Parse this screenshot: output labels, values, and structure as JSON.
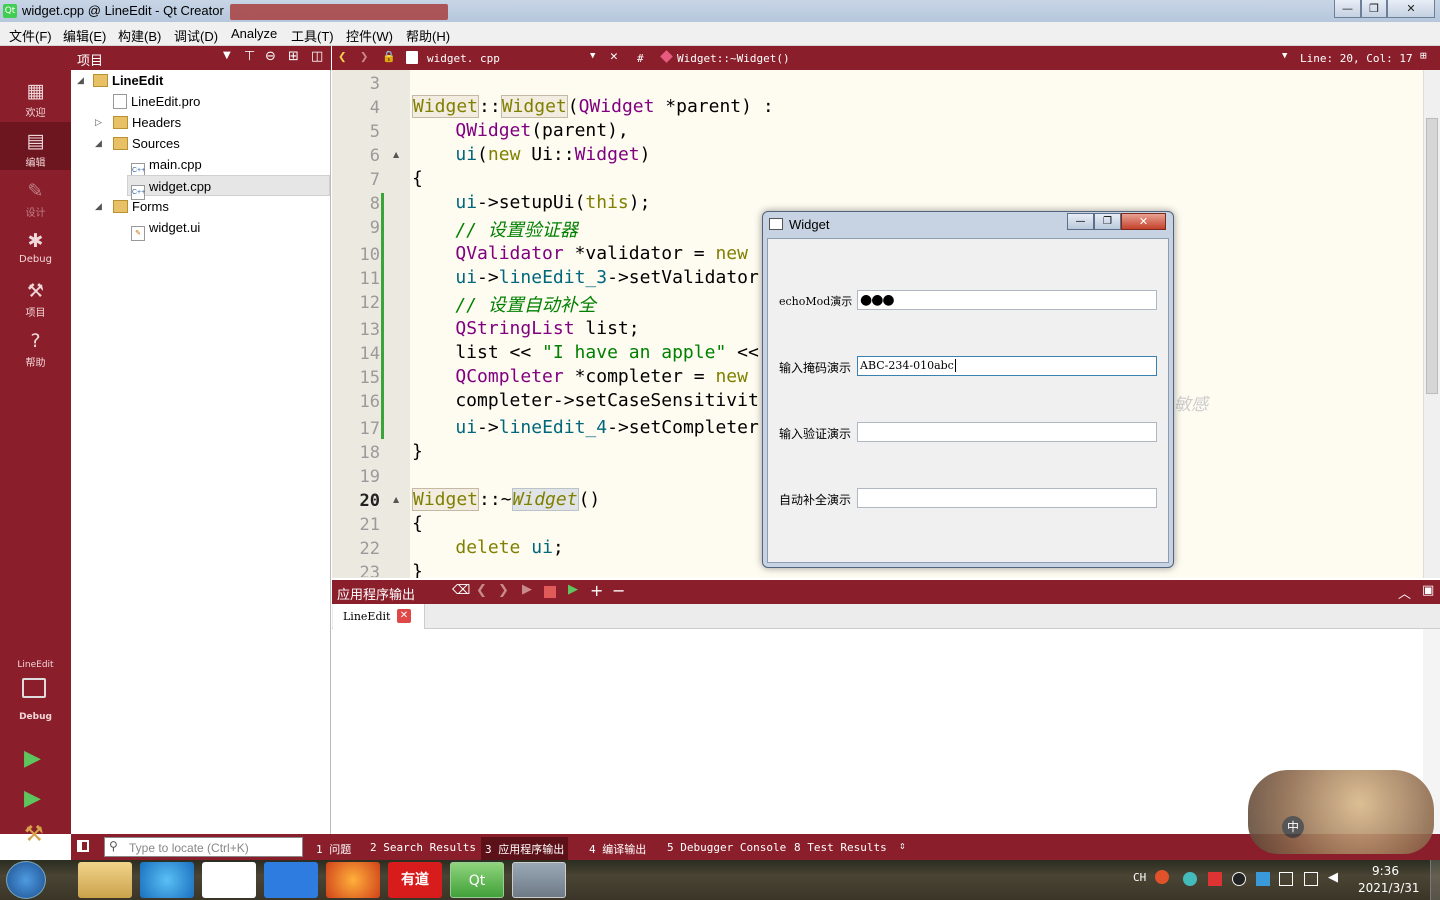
{
  "window": {
    "title": "widget.cpp @ LineEdit - Qt Creator",
    "min": "—",
    "max": "❐",
    "close": "✕"
  },
  "menu": [
    "文件(F)",
    "编辑(E)",
    "构建(B)",
    "调试(D)",
    "Analyze",
    "工具(T)",
    "控件(W)",
    "帮助(H)"
  ],
  "modes": [
    {
      "label": "欢迎",
      "icon": "grid-icon"
    },
    {
      "label": "编辑",
      "icon": "edit-icon"
    },
    {
      "label": "设计",
      "icon": "pencil-icon"
    },
    {
      "label": "Debug",
      "icon": "bug-icon"
    },
    {
      "label": "项目",
      "icon": "wrench-icon"
    },
    {
      "label": "帮助",
      "icon": "help-icon"
    }
  ],
  "kit": {
    "project": "LineEdit",
    "mode": "Debug"
  },
  "project_panel": {
    "title": "项目"
  },
  "tree": [
    {
      "label": "LineEdit"
    },
    {
      "label": "LineEdit.pro"
    },
    {
      "label": "Headers"
    },
    {
      "label": "Sources"
    },
    {
      "label": "main.cpp"
    },
    {
      "label": "widget.cpp"
    },
    {
      "label": "Forms"
    },
    {
      "label": "widget.ui"
    }
  ],
  "editor": {
    "file": "widget. cpp",
    "hash": "#",
    "symbol": "Widget::~Widget()",
    "position": "Line: 20, Col: 17"
  },
  "line_numbers": [
    "3",
    "4",
    "5",
    "6",
    "7",
    "8",
    "9",
    "10",
    "11",
    "12",
    "13",
    "14",
    "15",
    "16",
    "17",
    "18",
    "19",
    "20",
    "21",
    "22",
    "23"
  ],
  "code": {
    "l4_a": "Widget",
    "l4_b": "::",
    "l4_c": "Widget",
    "l4_d": "(",
    "l4_e": "QWidget",
    "l4_f": " *parent) :",
    "l5_a": "    ",
    "l5_b": "QWidget",
    "l5_c": "(parent),",
    "l6_a": "    ",
    "l6_b": "ui",
    "l6_c": "(",
    "l6_d": "new",
    "l6_e": " Ui::",
    "l6_f": "Widget",
    "l6_g": ")",
    "l7": "{",
    "l8_a": "    ",
    "l8_b": "ui",
    "l8_c": "->setupUi(",
    "l8_d": "this",
    "l8_e": ");",
    "l9": "    // 设置验证器",
    "l10_a": "    ",
    "l10_b": "QValidator",
    "l10_c": " *validator = ",
    "l10_d": "new",
    "l11_a": "    ",
    "l11_b": "ui",
    "l11_c": "->",
    "l11_d": "lineEdit_3",
    "l11_e": "->setValidator",
    "l12": "    // 设置自动补全",
    "l13_a": "    ",
    "l13_b": "QStringList",
    "l13_c": " list;",
    "l14_a": "    list << ",
    "l14_b": "\"I have an apple\"",
    "l14_c": " <<",
    "l15_a": "    ",
    "l15_b": "QCompleter",
    "l15_c": " *completer = ",
    "l15_d": "new",
    "l16": "    completer->setCaseSensitivit",
    "l17_a": "    ",
    "l17_b": "ui",
    "l17_c": "->",
    "l17_d": "lineEdit_4",
    "l17_e": "->setCompleter",
    "l18": "}",
    "l20_a": "Widget",
    "l20_b": "::~",
    "l20_c": "Widget",
    "l20_d": "()",
    "l21": "{",
    "l22_a": "    ",
    "l22_b": "delete",
    "l22_c": " ",
    "l22_d": "ui",
    "l22_e": ";",
    "l23": "}",
    "hidden_tail": "敏感"
  },
  "output": {
    "title": "应用程序输出",
    "tab": "LineEdit"
  },
  "status": {
    "locate_placeholder": "Type to locate (Ctrl+K)",
    "tabs": [
      "1  问题",
      "2  Search Results",
      "3  应用程序输出",
      "4  编译输出",
      "5  Debugger Console",
      "8  Test Results"
    ]
  },
  "widget_window": {
    "title": "Widget",
    "rows": [
      {
        "label": "echoMod演示",
        "value": "●●●"
      },
      {
        "label": "输入掩码演示",
        "value": "ABC-234-010abc"
      },
      {
        "label": "输入验证演示",
        "value": ""
      },
      {
        "label": "自动补全演示",
        "value": ""
      }
    ]
  },
  "taskbar": {
    "ime": "CH",
    "time": "9:36",
    "date": "2021/3/31"
  },
  "colors": {
    "mode_bar": "#8a1f2b",
    "editor_bg": "#fefbf1",
    "keyword": "#808000",
    "type": "#800080",
    "comment": "#008000"
  }
}
